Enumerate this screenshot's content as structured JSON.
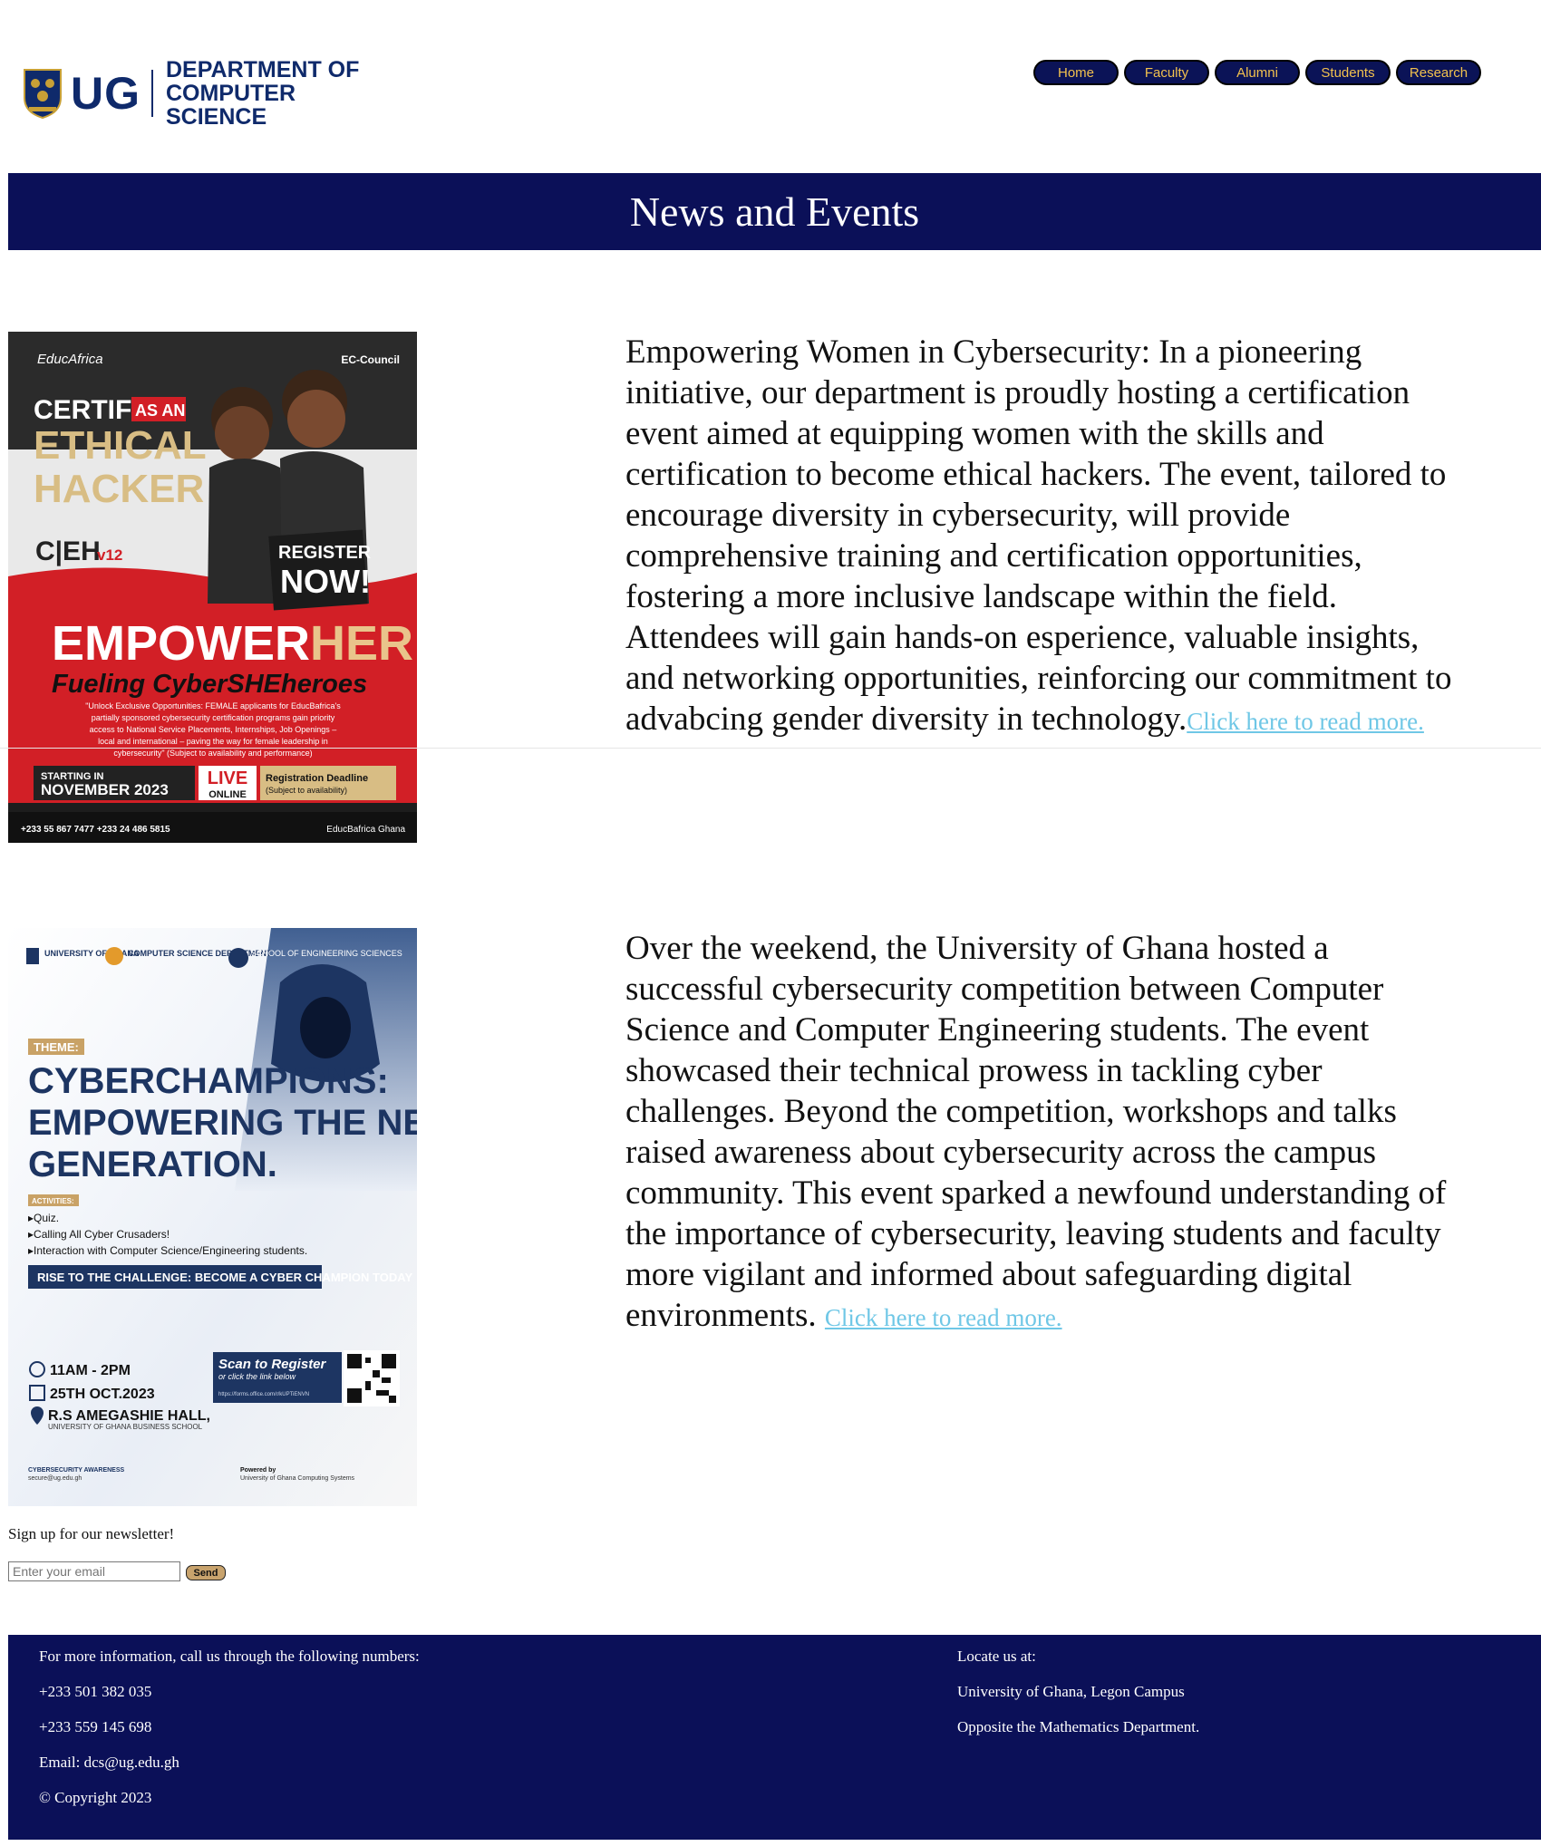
{
  "header": {
    "logo_abbr": "UG",
    "logo_dept_line1": "DEPARTMENT OF",
    "logo_dept_line2": "COMPUTER SCIENCE",
    "nav": [
      "Home",
      "Faculty",
      "Alumni",
      "Students",
      "Research"
    ]
  },
  "banner": {
    "title": "News and Events"
  },
  "articles": [
    {
      "text": "Empowering Women in Cybersecurity: In a pioneering initiative, our department is proudly hosting a certification event aimed at equipping women with the skills and certification to become ethical hackers. The event, tailored to encourage diversity in cybersecurity, will provide comprehensive training and certification opportunities, fostering a more inclusive landscape within the field. Attendees will gain hands-on esperience, valuable insights, and networking opportunities, reinforcing our commitment to advabcing gender diversity in technology.",
      "link": "Click here to read more."
    },
    {
      "text": "Over the weekend, the University of Ghana hosted a successful cybersecurity competition between Computer Science and Computer Engineering students. The event showcased their technical prowess in tackling cyber challenges. Beyond the competition, workshops and talks raised awareness about cybersecurity across the campus community. This event sparked a newfound understanding of the importance of cybersecurity, leaving students and faculty more vigilant and informed about safeguarding digital environments. ",
      "link": "Click here to read more."
    }
  ],
  "poster1": {
    "brand": "EducAfrica",
    "council": "EC-Council",
    "certify": "CERTIFY",
    "as_an": "AS AN",
    "ethical": "ETHICAL",
    "hacker": "HACKER",
    "ceh": "C|EH",
    "ceh_version": "v12",
    "register": "REGISTER",
    "now": "NOW!",
    "empower": "EMPOWER",
    "her": "HER",
    "tagline": "Fueling CyberSHEheroes",
    "small1": "\"Unlock Exclusive Opportunities: FEMALE applicants for EducBafrica's",
    "small2": "partially sponsored cybersecurity certification programs gain priority",
    "small3": "access to National Service Placements, Internships, Job Openings –",
    "small4": "local and international – paving the way for female leadership in",
    "small5": "cybersecurity\" (Subject to availability and performance)",
    "starting": "STARTING IN",
    "month": "NOVEMBER 2023",
    "live": "LIVE",
    "online": "ONLINE",
    "deadline": "Registration Deadline",
    "deadline_note": "(Subject to availability)",
    "phones": "+233 55 867 7477   +233 24 486 5815",
    "social": "EducBafrica Ghana"
  },
  "poster2": {
    "uni": "UNIVERSITY OF GHANA",
    "cs": "COMPUTER SCIENCE DEPARTMENT",
    "soe": "SCHOOL OF ENGINEERING SCIENCES",
    "theme": "THEME:",
    "title1": "CYBERCHAMPIONS:",
    "title2": "EMPOWERING THE NEXT",
    "title3": "GENERATION.",
    "activities": "ACTIVITIES:",
    "act1": "▸Quiz.",
    "act2": "▸Calling All Cyber Crusaders!",
    "act3": "▸Interaction with Computer Science/Engineering students.",
    "challenge": "RISE TO THE CHALLENGE: BECOME A CYBER CHAMPION TODAY",
    "time": "11AM - 2PM",
    "date": "25TH OCT.2023",
    "venue": "R.S AMEGASHIE HALL,",
    "venue_sub": "UNIVERSITY OF GHANA BUSINESS SCHOOL",
    "scan": "Scan to Register",
    "scan_sub": "or click the link below",
    "scan_link": "https://forms.office.com/r/kUPTiENVN",
    "aware": "CYBERSECURITY AWARENESS",
    "aware_mail": "secure@ug.edu.gh",
    "powered": "Powered by",
    "powered_by": "University of Ghana Computing Systems"
  },
  "newsletter": {
    "label": "Sign up for our newsletter!",
    "placeholder": "Enter your email",
    "button": "Send"
  },
  "footer": {
    "info": "For more information, call us through the following numbers:",
    "phone1": "+233 501 382 035",
    "phone2": "+233 559 145 698",
    "email": "Email: dcs@ug.edu.gh",
    "copyright": "© Copyright 2023",
    "locate": "Locate us at:",
    "campus": "University of Ghana, Legon Campus",
    "landmark": "Opposite the Mathematics Department."
  },
  "colors": {
    "navy": "#0b1058",
    "nav_text": "#f2c14e",
    "link": "#6fc7e6"
  }
}
